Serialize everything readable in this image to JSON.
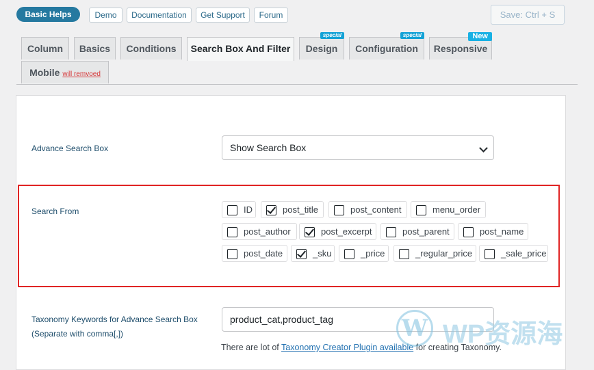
{
  "topbar": {
    "help_label": "Basic Helps",
    "links": [
      "Demo",
      "Documentation",
      "Get Support",
      "Forum"
    ],
    "save_label": "Save: Ctrl + S"
  },
  "tabs": [
    {
      "label": "Column"
    },
    {
      "label": "Basics"
    },
    {
      "label": "Conditions"
    },
    {
      "label": "Search Box And Filter",
      "active": true
    },
    {
      "label": "Design",
      "badge": "special"
    },
    {
      "label": "Configuration",
      "badge": "special"
    },
    {
      "label": "Responsive",
      "badge": "New"
    },
    {
      "label": "Mobile",
      "sub": "will remvoed"
    }
  ],
  "advance_search": {
    "label": "Advance Search Box",
    "selected": "Show Search Box"
  },
  "search_from": {
    "label": "Search From",
    "options": [
      {
        "label": "ID",
        "checked": false
      },
      {
        "label": "post_title",
        "checked": true
      },
      {
        "label": "post_content",
        "checked": false
      },
      {
        "label": "menu_order",
        "checked": false
      },
      {
        "label": "post_author",
        "checked": false
      },
      {
        "label": "post_excerpt",
        "checked": true
      },
      {
        "label": "post_parent",
        "checked": false
      },
      {
        "label": "post_name",
        "checked": false
      },
      {
        "label": "post_date",
        "checked": false
      },
      {
        "label": "_sku",
        "checked": true
      },
      {
        "label": "_price",
        "checked": false
      },
      {
        "label": "_regular_price",
        "checked": false
      },
      {
        "label": "_sale_price",
        "checked": false
      }
    ]
  },
  "taxonomy": {
    "label_line1": "Taxonomy Keywords for Advance Search Box",
    "label_line2": "(Separate with comma[,])",
    "value": "product_cat,product_tag",
    "help_prefix": "There are lot of ",
    "help_link": "Taxonomy Creator Plugin available",
    "help_suffix": " for creating Taxonomy."
  },
  "watermark": {
    "logo": "W",
    "text": "WP资源海"
  },
  "colors": {
    "accent": "#2579a0",
    "highlight_border": "#e02424",
    "badge": "#14a2d6"
  }
}
